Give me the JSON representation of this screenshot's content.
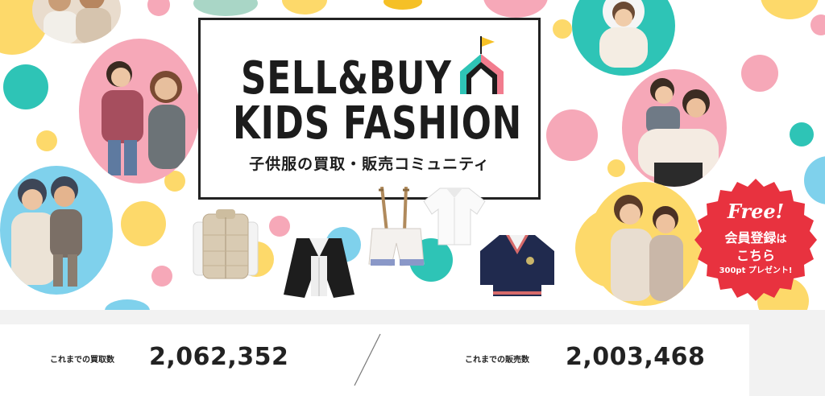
{
  "hero": {
    "logo_line1": "SELL&BUY",
    "logo_line2": "KIDS FASHION",
    "logo_sub": "子供服の買取・販売コミュニティ",
    "colors": {
      "pink": "#f6a8b8",
      "teal": "#2ec4b6",
      "yellow": "#fdd96a",
      "blue": "#7fd1ec",
      "house_flag": "#f5c026",
      "house_left": "#2ec4b6",
      "house_right": "#f27c8e"
    }
  },
  "badge": {
    "free": "Free!",
    "line1_main": "会員登録",
    "line1_small": "は",
    "line2": "こちら",
    "line3": "300pt プレゼント!",
    "color": "#e8323f"
  },
  "stats": {
    "buy_label": "これまでの買取数",
    "buy_value": "2,062,352",
    "sell_label": "これまでの販売数",
    "sell_value": "2,003,468"
  },
  "icons": [
    "house-logo-icon",
    "vest-icon",
    "leather-jacket-icon",
    "suspender-shorts-icon",
    "white-shirt-icon",
    "navy-sweater-icon",
    "slash-divider-icon"
  ]
}
